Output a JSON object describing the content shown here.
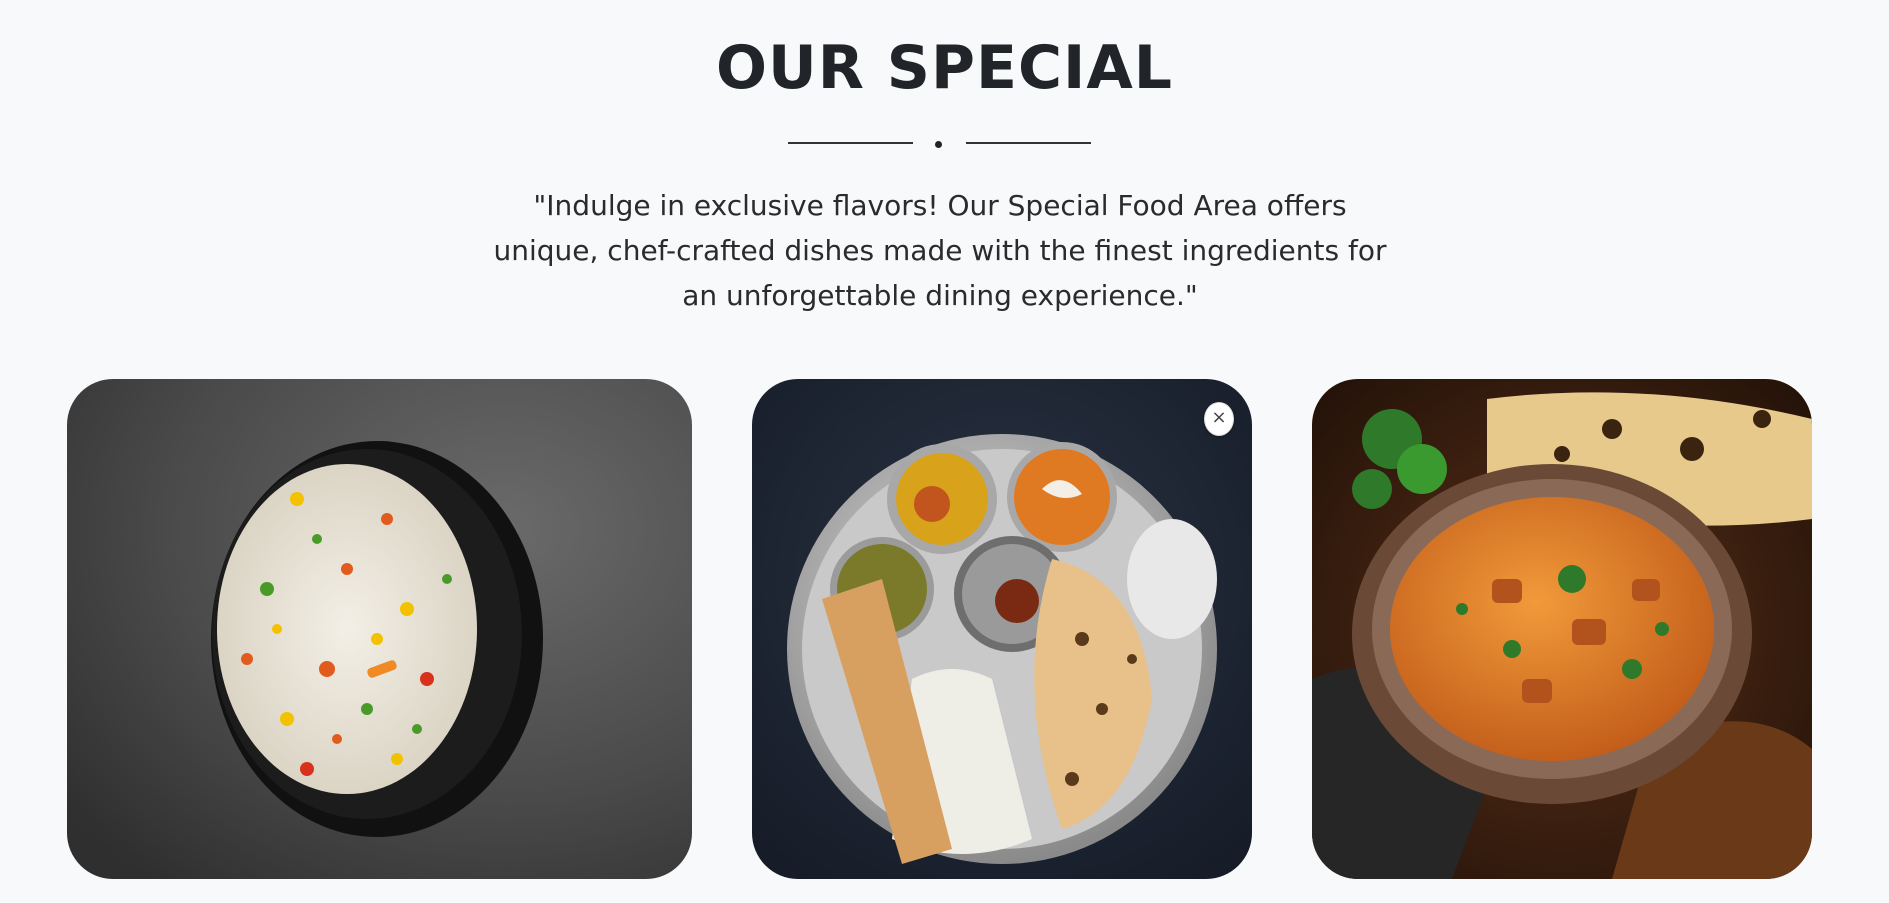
{
  "section": {
    "title": "OUR SPECIAL",
    "description": "\"Indulge in exclusive flavors! Our Special Food Area offers unique, chef-crafted dishes made with the finest ingredients for an unforgettable dining experience.\""
  },
  "cards": [
    {
      "dish_icon": "vegetable-fried-rice-image"
    },
    {
      "dish_icon": "indian-thali-image",
      "close_label": "×"
    },
    {
      "dish_icon": "butter-chicken-image"
    }
  ],
  "colors": {
    "background": "#f8f9fa",
    "title": "#212529",
    "divider": "#333333"
  }
}
